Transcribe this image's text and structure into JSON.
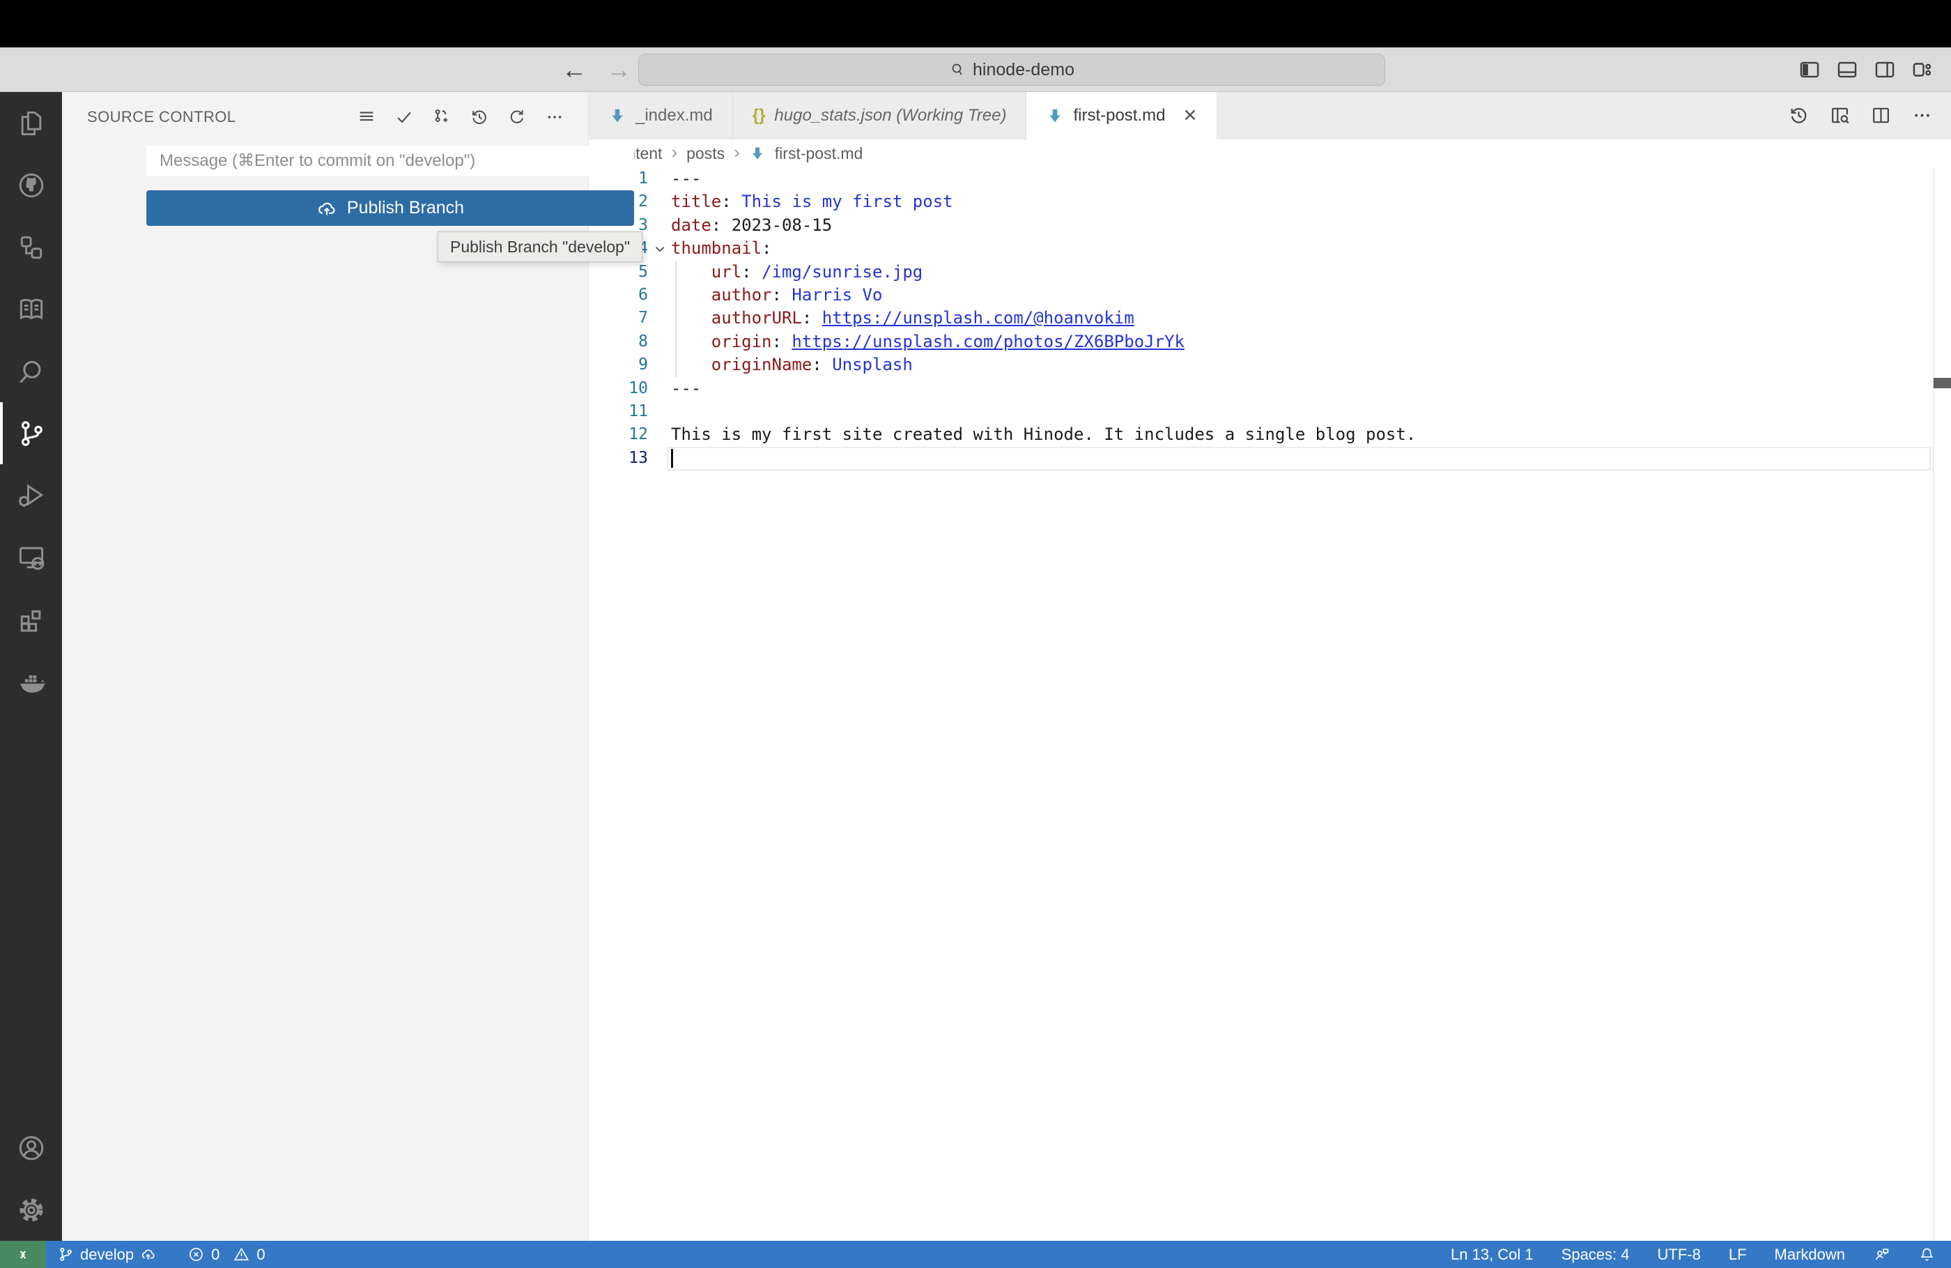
{
  "titlebar": {
    "search_value": "hinode-demo"
  },
  "icons": {
    "back": "←",
    "forward": "→",
    "close": "✕",
    "breadcrumb_sep": "›",
    "json_glyph": "{}"
  },
  "source_control": {
    "title": "SOURCE CONTROL",
    "message_placeholder": "Message (⌘Enter to commit on \"develop\")",
    "publish_button": "Publish Branch"
  },
  "tooltip": {
    "text": "Publish Branch \"develop\""
  },
  "tabs": [
    {
      "label": "_index.md"
    },
    {
      "label": "hugo_stats.json (Working Tree)"
    },
    {
      "label": "first-post.md"
    }
  ],
  "breadcrumb": {
    "items": [
      "content",
      "posts",
      "first-post.md"
    ]
  },
  "editor": {
    "lines": [
      {
        "num": "1",
        "tokens": [
          {
            "c": "plain",
            "v": "---"
          }
        ]
      },
      {
        "num": "2",
        "tokens": [
          {
            "c": "key",
            "v": "title"
          },
          {
            "c": "plain",
            "v": ": "
          },
          {
            "c": "str",
            "v": "This is my first post"
          }
        ]
      },
      {
        "num": "3",
        "tokens": [
          {
            "c": "key",
            "v": "date"
          },
          {
            "c": "plain",
            "v": ": "
          },
          {
            "c": "plain",
            "v": "2023-08-15"
          }
        ]
      },
      {
        "num": "4",
        "tokens": [
          {
            "c": "key",
            "v": "thumbnail"
          },
          {
            "c": "plain",
            "v": ":"
          }
        ]
      },
      {
        "num": "5",
        "tokens": [
          {
            "c": "plain",
            "v": "    "
          },
          {
            "c": "key",
            "v": "url"
          },
          {
            "c": "plain",
            "v": ": "
          },
          {
            "c": "str",
            "v": "/img/sunrise.jpg"
          }
        ]
      },
      {
        "num": "6",
        "tokens": [
          {
            "c": "plain",
            "v": "    "
          },
          {
            "c": "key",
            "v": "author"
          },
          {
            "c": "plain",
            "v": ": "
          },
          {
            "c": "str",
            "v": "Harris Vo"
          }
        ]
      },
      {
        "num": "7",
        "tokens": [
          {
            "c": "plain",
            "v": "    "
          },
          {
            "c": "key",
            "v": "authorURL"
          },
          {
            "c": "plain",
            "v": ": "
          },
          {
            "c": "link",
            "v": "https://unsplash.com/@hoanvokim"
          }
        ]
      },
      {
        "num": "8",
        "tokens": [
          {
            "c": "plain",
            "v": "    "
          },
          {
            "c": "key",
            "v": "origin"
          },
          {
            "c": "plain",
            "v": ": "
          },
          {
            "c": "link",
            "v": "https://unsplash.com/photos/ZX6BPboJrYk"
          }
        ]
      },
      {
        "num": "9",
        "tokens": [
          {
            "c": "plain",
            "v": "    "
          },
          {
            "c": "key",
            "v": "originName"
          },
          {
            "c": "plain",
            "v": ": "
          },
          {
            "c": "str",
            "v": "Unsplash"
          }
        ]
      },
      {
        "num": "10",
        "tokens": [
          {
            "c": "plain",
            "v": "---"
          }
        ]
      },
      {
        "num": "11",
        "tokens": []
      },
      {
        "num": "12",
        "tokens": [
          {
            "c": "plain",
            "v": "This is my first site created with Hinode. It includes a single blog post."
          }
        ]
      },
      {
        "num": "13",
        "tokens": []
      }
    ]
  },
  "status_bar": {
    "branch": "develop",
    "errors": "0",
    "warnings": "0",
    "cursor_position": "Ln 13, Col 1",
    "indentation": "Spaces: 4",
    "encoding": "UTF-8",
    "eol": "LF",
    "language": "Markdown"
  },
  "colors": {
    "statusbar": "#3478c6",
    "remote_indicator": "#4a8a62",
    "button": "#2e6ca6",
    "activitybar": "#2d2d2d",
    "yaml_key": "#8b1a1a",
    "yaml_value": "#2533d4"
  }
}
